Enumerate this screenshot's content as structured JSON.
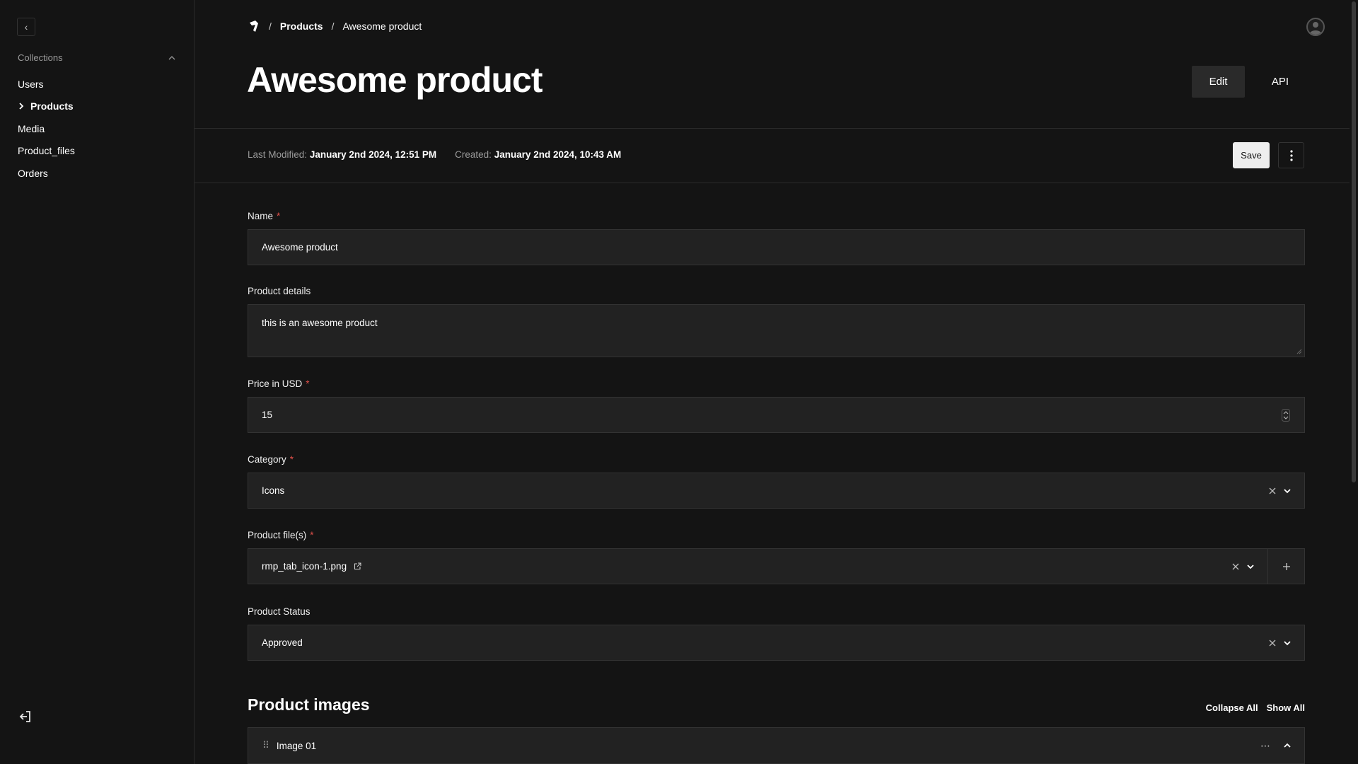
{
  "sidebar": {
    "toggle_icon": "chevron-left-icon",
    "collections_label": "Collections",
    "items": [
      {
        "label": "Users"
      },
      {
        "label": "Products"
      },
      {
        "label": "Media"
      },
      {
        "label": "Product_files"
      },
      {
        "label": "Orders"
      }
    ],
    "logout_icon": "logout-icon"
  },
  "header": {
    "breadcrumb": {
      "section": "Products",
      "current": "Awesome product"
    },
    "title": "Awesome product",
    "edit_label": "Edit",
    "api_label": "API"
  },
  "meta": {
    "last_modified_label": "Last Modified:",
    "last_modified_value": "January 2nd 2024, 12:51 PM",
    "created_label": "Created:",
    "created_value": "January 2nd 2024, 10:43 AM",
    "save_label": "Save"
  },
  "form": {
    "name": {
      "label": "Name",
      "required": "*",
      "value": "Awesome product"
    },
    "details": {
      "label": "Product details",
      "value": "this is an awesome product"
    },
    "price": {
      "label": "Price in USD",
      "required": "*",
      "value": "15"
    },
    "category": {
      "label": "Category",
      "required": "*",
      "value": "Icons"
    },
    "files": {
      "label": "Product file(s)",
      "required": "*",
      "value": "rmp_tab_icon-1.png"
    },
    "status": {
      "label": "Product Status",
      "value": "Approved"
    }
  },
  "images": {
    "title": "Product images",
    "collapse_all": "Collapse All",
    "show_all": "Show All",
    "rows": [
      {
        "label": "Image 01"
      }
    ]
  },
  "colors": {
    "background": "#141414",
    "field_bg": "#222222",
    "required": "#e0504a",
    "save_bg": "#eeeeee"
  }
}
